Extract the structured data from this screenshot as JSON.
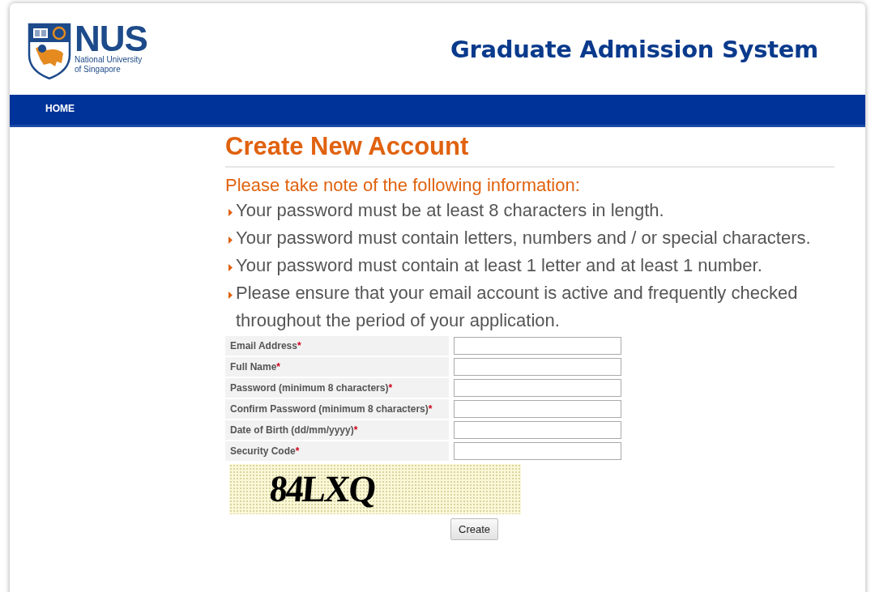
{
  "header": {
    "logo": {
      "wordmark": "NUS",
      "line_1": "National University",
      "line_2": "of Singapore"
    },
    "title": "Graduate Admission System"
  },
  "nav": [
    {
      "label": "HOME"
    }
  ],
  "page": {
    "heading": "Create New Account",
    "note_title": "Please take note of the following information:",
    "notes": [
      "Your password must be at least 8 characters in length.",
      "Your password must contain letters, numbers and / or special characters.",
      "Your password must contain at least 1 letter and at least 1 number.",
      "Please ensure that your email account is active and frequently checked throughout the period of your application."
    ]
  },
  "form": {
    "fields": [
      {
        "label": "Email Address",
        "mark": "*"
      },
      {
        "label": "Full Name",
        "mark": "*"
      },
      {
        "label": "Password (minimum 8 characters)",
        "mark": "*"
      },
      {
        "label": "Confirm Password (minimum 8 characters)",
        "mark": "*"
      },
      {
        "label": "Date of Birth (dd/mm/yyyy)",
        "mark": "*"
      },
      {
        "label": "Security Code",
        "mark": "*"
      }
    ],
    "captcha": "84LXQ",
    "submit": "Create"
  }
}
